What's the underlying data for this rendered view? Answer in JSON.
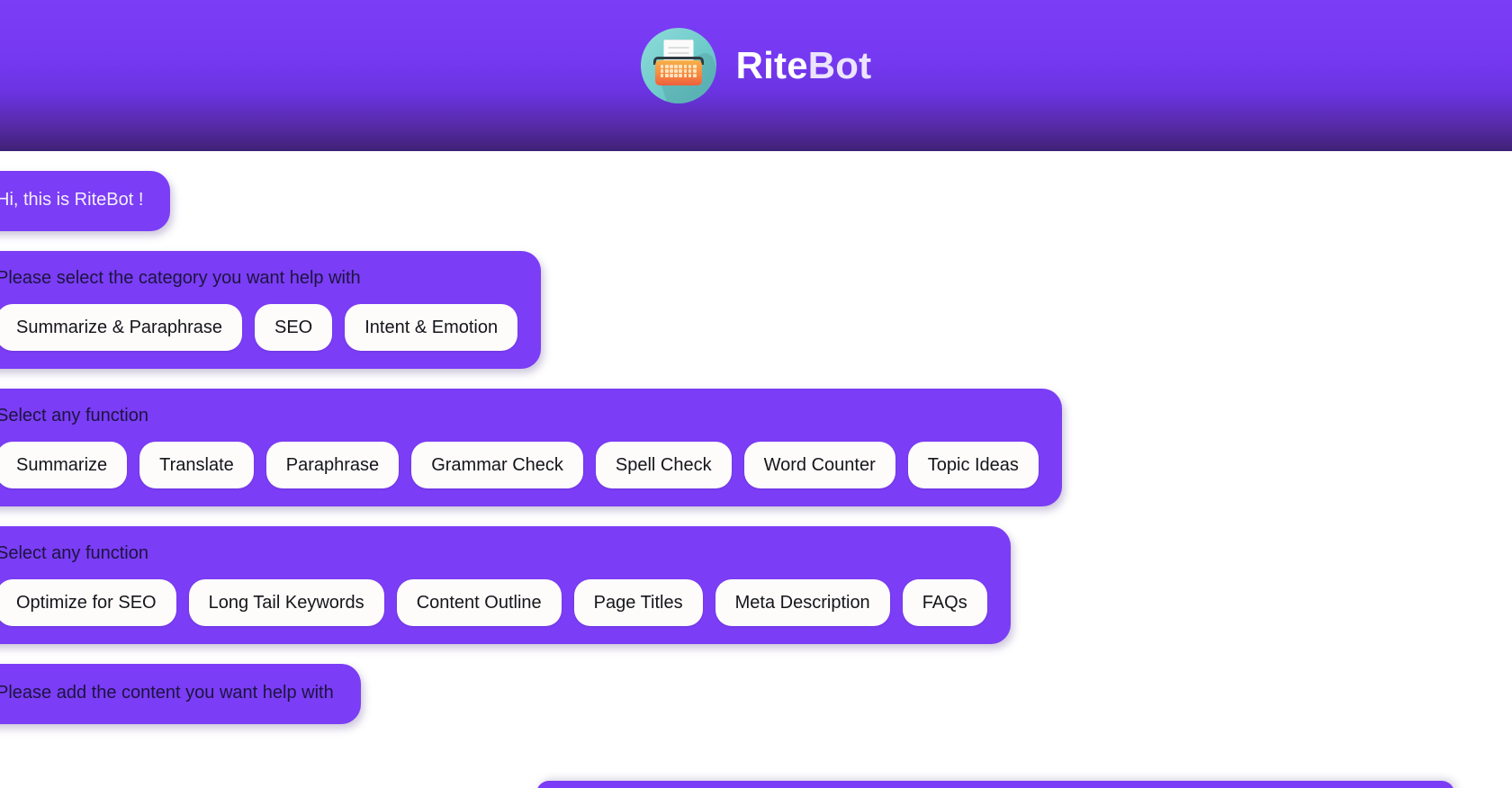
{
  "header": {
    "brand_first": "Rite",
    "brand_second": "Bot",
    "logo_icon": "typewriter-icon",
    "bg_color": "#7b3df5",
    "bg_bottom_color": "#3e2175"
  },
  "colors": {
    "bubble": "#7b3df5",
    "chip_bg": "#fdfcfb",
    "chip_text": "#15151a",
    "page_bg": "#ffffff"
  },
  "chat": {
    "messages": [
      {
        "id": "greeting",
        "text": "Hi, this is RiteBot !",
        "chips": []
      },
      {
        "id": "category-prompt",
        "text": "Please select the category you want help with",
        "chips": [
          "Summarize & Paraphrase",
          "SEO",
          "Intent & Emotion"
        ]
      },
      {
        "id": "function-prompt-1",
        "text": "Select any function",
        "chips": [
          "Summarize",
          "Translate",
          "Paraphrase",
          "Grammar Check",
          "Spell Check",
          "Word Counter",
          "Topic Ideas"
        ]
      },
      {
        "id": "function-prompt-2",
        "text": "Select any function",
        "chips": [
          "Optimize for SEO",
          "Long Tail Keywords",
          "Content Outline",
          "Page Titles",
          "Meta Description",
          "FAQs"
        ]
      },
      {
        "id": "content-prompt",
        "text": "Please add the content you want help with",
        "chips": []
      }
    ]
  }
}
